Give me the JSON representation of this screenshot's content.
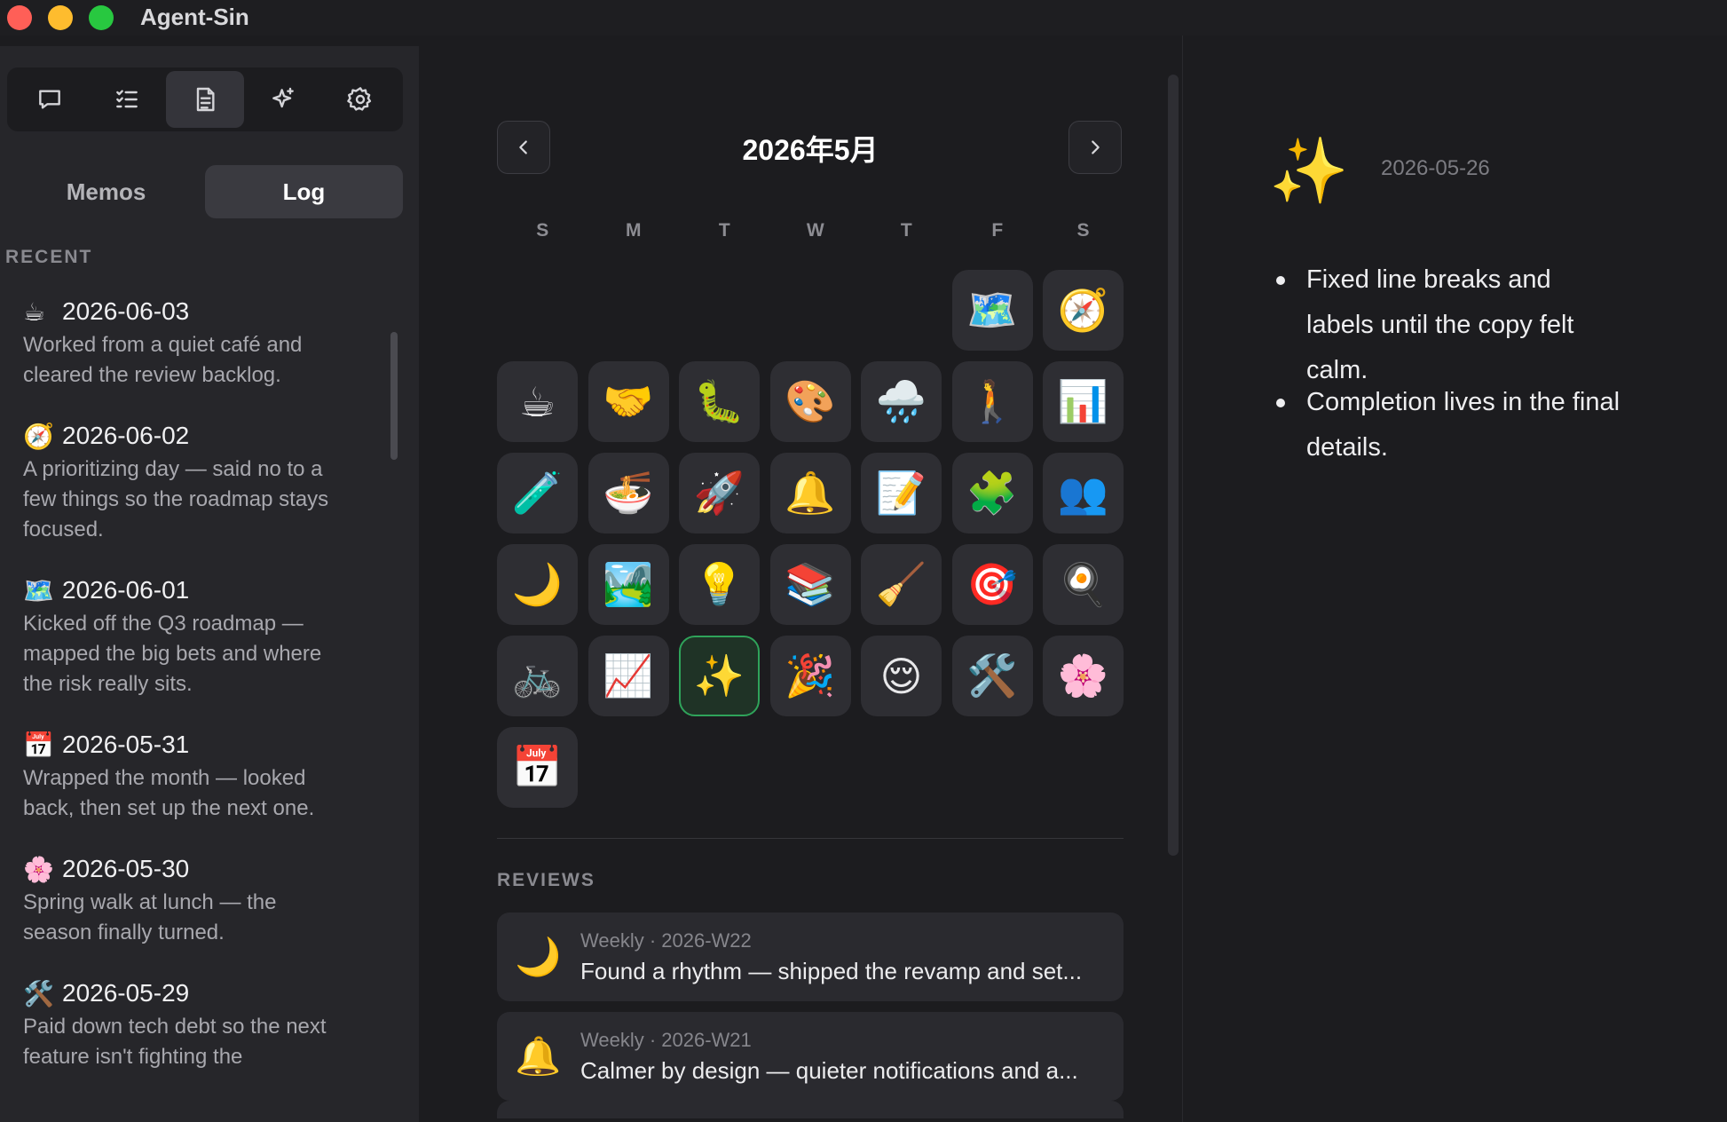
{
  "app": {
    "title": "Agent-Sin"
  },
  "toolbar": {
    "items": [
      {
        "name": "chat",
        "icon": "chat-bubble-icon"
      },
      {
        "name": "tasks",
        "icon": "checklist-icon"
      },
      {
        "name": "notes",
        "icon": "document-icon"
      },
      {
        "name": "skills",
        "icon": "sparkle-icon"
      },
      {
        "name": "settings",
        "icon": "gear-icon"
      }
    ],
    "active": "notes"
  },
  "segmented": {
    "memos": "Memos",
    "log": "Log",
    "active": "log"
  },
  "recent": {
    "label": "RECENT",
    "entries": [
      {
        "icon": "☕",
        "date": "2026-06-03",
        "text": "Worked from a quiet café and cleared the review backlog."
      },
      {
        "icon": "🧭",
        "date": "2026-06-02",
        "text": "A prioritizing day — said no to a few things so the roadmap stays focused."
      },
      {
        "icon": "🗺️",
        "date": "2026-06-01",
        "text": "Kicked off the Q3 roadmap — mapped the big bets and where the risk really sits."
      },
      {
        "icon": "📅",
        "date": "2026-05-31",
        "text": "Wrapped the month — looked back, then set up the next one."
      },
      {
        "icon": "🌸",
        "date": "2026-05-30",
        "text": "Spring walk at lunch — the season finally turned."
      },
      {
        "icon": "🛠️",
        "date": "2026-05-29",
        "text": "Paid down tech debt so the next feature isn't fighting the"
      }
    ]
  },
  "calendar": {
    "title": "2026年5月",
    "weekdays": [
      "S",
      "M",
      "T",
      "W",
      "T",
      "F",
      "S"
    ],
    "cells": [
      "",
      "",
      "",
      "",
      "",
      "🗺️",
      "🧭",
      "☕",
      "🤝",
      "🐛",
      "🎨",
      "🌧️",
      "🚶",
      "📊",
      "🧪",
      "🍜",
      "🚀",
      "🔔",
      "📝",
      "🧩",
      "👥",
      "🌙",
      "🏞️",
      "💡",
      "📚",
      "🧹",
      "🎯",
      "🍳",
      "🚲",
      "📈",
      "✨",
      "🎉",
      "😌",
      "🛠️",
      "🌸",
      "📅"
    ],
    "selected_index": 30
  },
  "reviews": {
    "label": "REVIEWS",
    "items": [
      {
        "icon": "🌙",
        "meta": "Weekly · 2026-W22",
        "title": "Found a rhythm — shipped the revamp and set..."
      },
      {
        "icon": "🔔",
        "meta": "Weekly · 2026-W21",
        "title": "Calmer by design — quieter notifications and a..."
      }
    ]
  },
  "detail": {
    "icon": "✨",
    "date": "2026-05-26",
    "bullets": [
      "Fixed line breaks and labels until the copy felt calm.",
      "Completion lives in the final details."
    ]
  }
}
